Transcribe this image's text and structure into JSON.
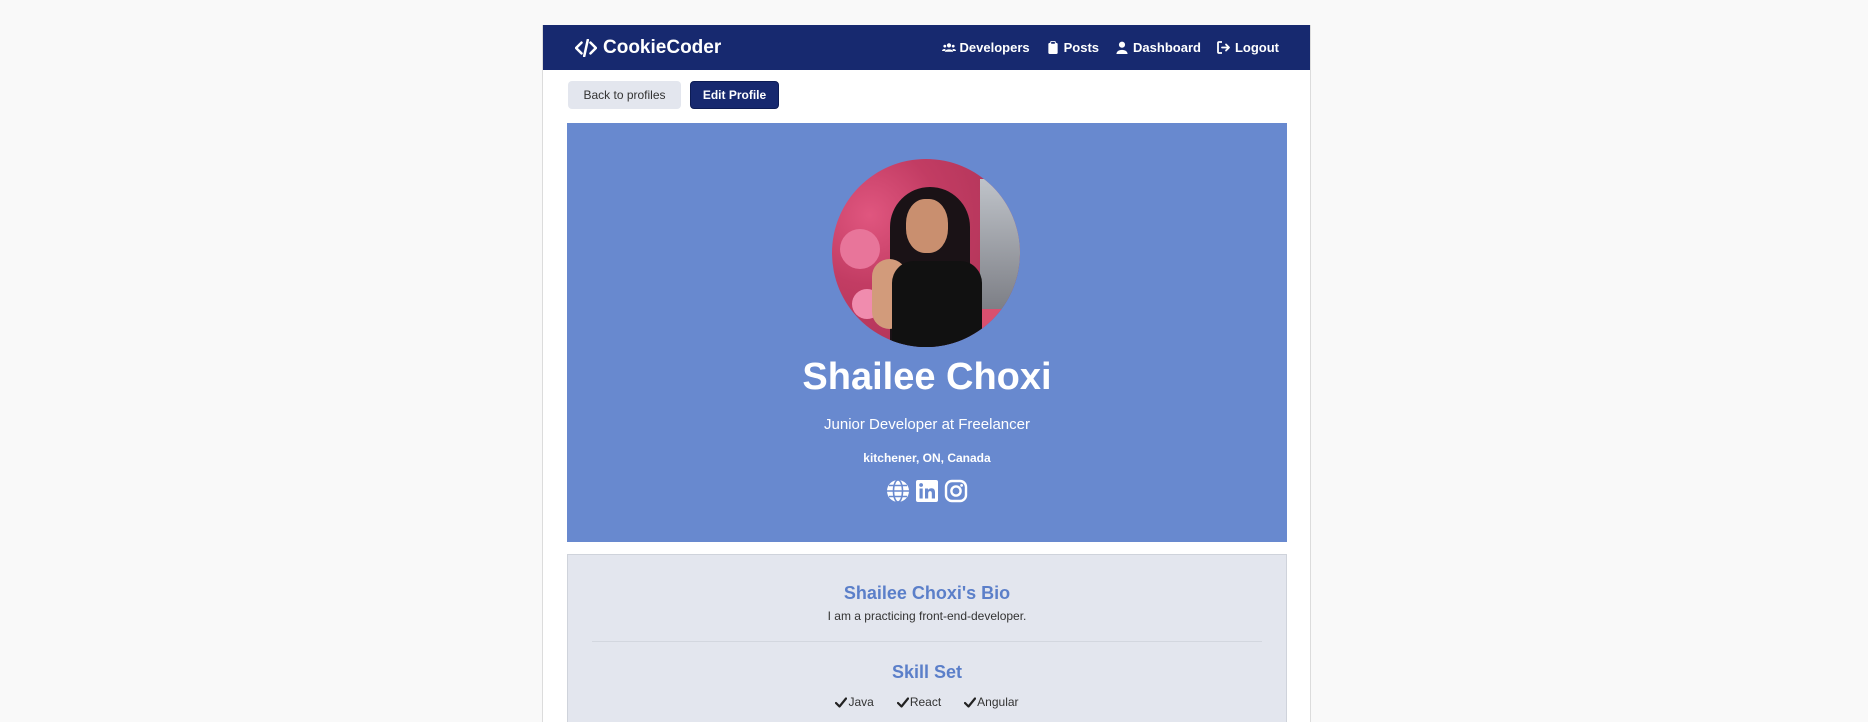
{
  "brand": {
    "name": "CookieCoder",
    "icon": "code-icon"
  },
  "nav": {
    "items": [
      {
        "label": "Developers",
        "icon": "users-icon"
      },
      {
        "label": "Posts",
        "icon": "clipboard-icon"
      },
      {
        "label": "Dashboard",
        "icon": "user-icon"
      },
      {
        "label": "Logout",
        "icon": "logout-icon"
      }
    ]
  },
  "actions": {
    "back_label": "Back to profiles",
    "edit_label": "Edit Profile"
  },
  "profile": {
    "name": "Shailee Choxi",
    "title": "Junior Developer at Freelancer",
    "location": "kitchener, ON, Canada",
    "socials": [
      "globe-icon",
      "linkedin-icon",
      "instagram-icon"
    ]
  },
  "bio": {
    "heading": "Shailee Choxi's Bio",
    "text": "I am a practicing front-end-developer.",
    "skills_heading": "Skill Set",
    "skills": [
      "Java",
      "React",
      "Angular"
    ]
  },
  "colors": {
    "navbar": "#17296f",
    "hero": "#6889cf",
    "bio_bg": "#e3e6ee",
    "heading_accent": "#5b7fc9",
    "page_bg": "#f9f9f9"
  }
}
